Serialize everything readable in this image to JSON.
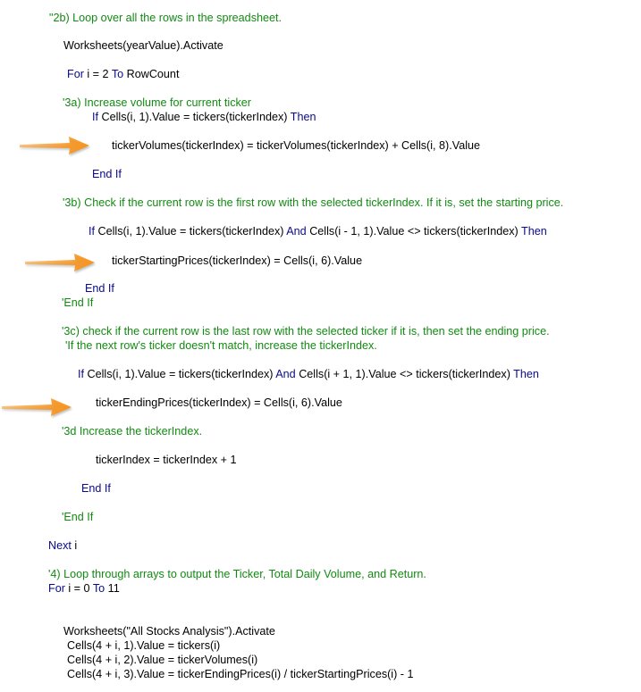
{
  "colors": {
    "comment": "#128a12",
    "keyword": "#0a0a8a",
    "plain": "#000000",
    "arrow": "#f7941d"
  },
  "code_lines": [
    [
      {
        "t": "\"2b) Loop over all the rows in the spreadsheet.",
        "k": "comment"
      }
    ],
    [
      {
        "t": "Worksheets(yearValue).Activate",
        "k": "plain"
      }
    ],
    [
      {
        "t": "For",
        "k": "keyword"
      },
      {
        "t": " i = 2 ",
        "k": "plain"
      },
      {
        "t": "To",
        "k": "keyword"
      },
      {
        "t": " RowCount",
        "k": "plain"
      }
    ],
    [
      {
        "t": "'3a) Increase volume for current ticker",
        "k": "comment"
      }
    ],
    [
      {
        "t": "If",
        "k": "keyword"
      },
      {
        "t": " Cells(i, 1).Value = tickers(tickerIndex) ",
        "k": "plain"
      },
      {
        "t": "Then",
        "k": "keyword"
      }
    ],
    [
      {
        "t": "tickerVolumes(tickerIndex) = tickerVolumes(tickerIndex) + Cells(i, 8).Value",
        "k": "plain"
      }
    ],
    [
      {
        "t": "End If",
        "k": "keyword"
      }
    ],
    [
      {
        "t": "'3b) Check if the current row is the first row with the selected tickerIndex. If it is, set the starting price.",
        "k": "comment"
      }
    ],
    [
      {
        "t": "If",
        "k": "keyword"
      },
      {
        "t": " Cells(i, 1).Value = tickers(tickerIndex) ",
        "k": "plain"
      },
      {
        "t": "And",
        "k": "keyword"
      },
      {
        "t": " Cells(i - 1, 1).Value <> tickers(tickerIndex) ",
        "k": "plain"
      },
      {
        "t": "Then",
        "k": "keyword"
      }
    ],
    [
      {
        "t": "tickerStartingPrices(tickerIndex) = Cells(i, 6).Value",
        "k": "plain"
      }
    ],
    [
      {
        "t": "End If",
        "k": "keyword"
      }
    ],
    [
      {
        "t": "'End If",
        "k": "comment"
      }
    ],
    [
      {
        "t": "'3c) check if the current row is the last row with the selected ticker if it is, then set the ending price.",
        "k": "comment"
      }
    ],
    [
      {
        "t": "'If the next row's ticker doesn't match, increase the tickerIndex.",
        "k": "comment"
      }
    ],
    [
      {
        "t": "If",
        "k": "keyword"
      },
      {
        "t": " Cells(i, 1).Value = tickers(tickerIndex) ",
        "k": "plain"
      },
      {
        "t": "And",
        "k": "keyword"
      },
      {
        "t": " Cells(i + 1, 1).Value <> tickers(tickerIndex) ",
        "k": "plain"
      },
      {
        "t": "Then",
        "k": "keyword"
      }
    ],
    [
      {
        "t": "tickerEndingPrices(tickerIndex) = Cells(i, 6).Value",
        "k": "plain"
      }
    ],
    [
      {
        "t": "'3d Increase the tickerIndex.",
        "k": "comment"
      }
    ],
    [
      {
        "t": "tickerIndex = tickerIndex + 1",
        "k": "plain"
      }
    ],
    [
      {
        "t": "End If",
        "k": "keyword"
      }
    ],
    [
      {
        "t": "'End If",
        "k": "comment"
      }
    ],
    [
      {
        "t": "Next",
        "k": "keyword"
      },
      {
        "t": " i",
        "k": "plain"
      }
    ],
    [
      {
        "t": "'4) Loop through arrays to output the Ticker, Total Daily Volume, and Return.",
        "k": "comment"
      }
    ],
    [
      {
        "t": "For",
        "k": "keyword"
      },
      {
        "t": " i = 0 ",
        "k": "plain"
      },
      {
        "t": "To",
        "k": "keyword"
      },
      {
        "t": " 11",
        "k": "plain"
      }
    ],
    [
      {
        "t": "Worksheets(\"All Stocks Analysis\").Activate",
        "k": "plain"
      }
    ],
    [
      {
        "t": "Cells(4 + i, 1).Value = tickers(i)",
        "k": "plain"
      }
    ],
    [
      {
        "t": "Cells(4 + i, 2).Value = tickerVolumes(i)",
        "k": "plain"
      }
    ],
    [
      {
        "t": "Cells(4 + i, 3).Value = tickerEndingPrices(i) / tickerStartingPrices(i) - 1",
        "k": "plain"
      }
    ]
  ],
  "arrows": [
    {
      "icon": "arrow-right-icon",
      "points_to_line": 5
    },
    {
      "icon": "arrow-right-icon",
      "points_to_line": 9
    },
    {
      "icon": "arrow-right-icon",
      "points_to_line": 15
    }
  ]
}
